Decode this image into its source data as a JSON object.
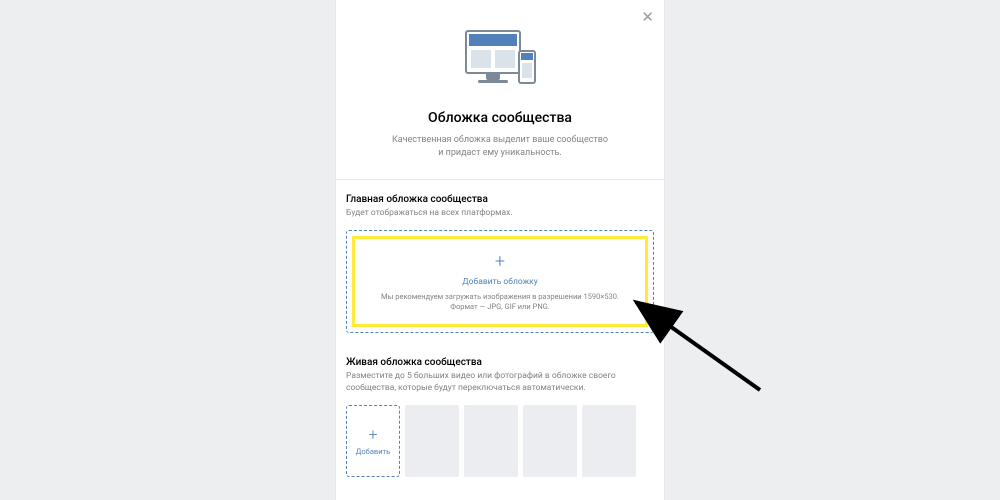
{
  "hero": {
    "title": "Обложка сообщества",
    "subtitle_line1": "Качественная обложка выделит ваше сообщество",
    "subtitle_line2": "и придаст ему уникальность."
  },
  "main_cover": {
    "title": "Главная обложка сообщества",
    "desc": "Будет отображаться на всех платформах.",
    "add_label": "Добавить обложку",
    "rec_line1": "Мы рекомендуем загружать изображения в разрешении 1590×530.",
    "rec_line2": "Формат — JPG, GIF или PNG."
  },
  "live_cover": {
    "title": "Живая обложка сообщества",
    "desc": "Разместите до 5 больших видео или фотографий в обложке своего сообщества, которые будут переключаться автоматически.",
    "add_label": "Добавить"
  },
  "icons": {
    "close": "✕",
    "plus": "+"
  }
}
